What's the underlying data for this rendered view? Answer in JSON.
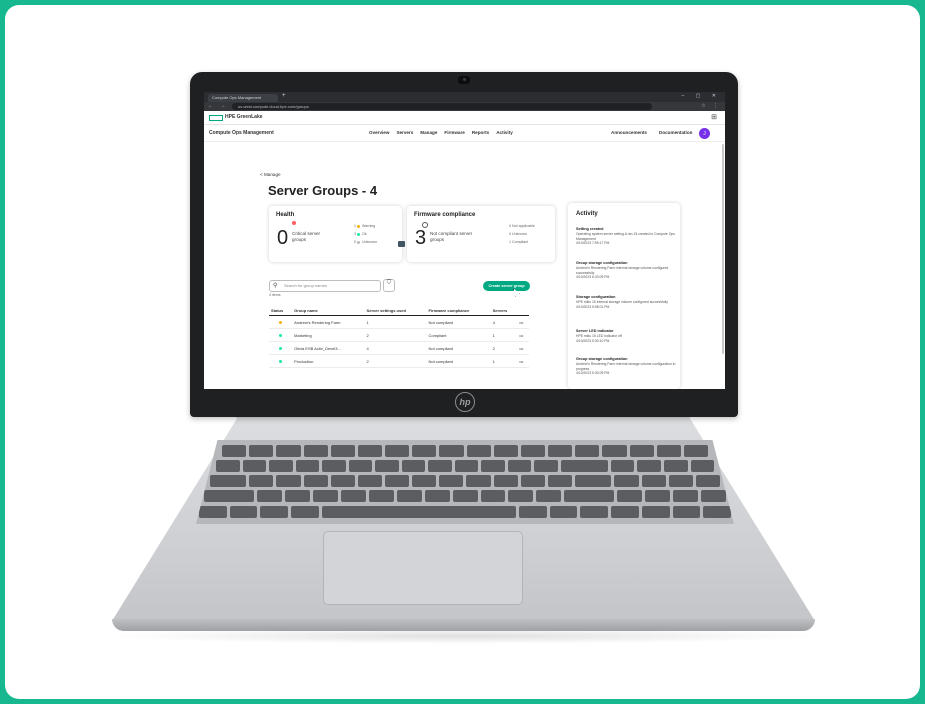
{
  "browser": {
    "tab_title": "Compute Ops Management",
    "tab_plus": "+",
    "window_controls": "– ▢ ✕",
    "nav_buttons": "← → ⟳",
    "url": "us-west.compute.cloud.hpe.com/groups",
    "toolbar_icons": "☆ ⋮"
  },
  "header": {
    "brand": "HPE GreenLake",
    "app_title": "Compute Ops Management",
    "nav": [
      "Overview",
      "Servers",
      "Manage",
      "Firmware",
      "Reports",
      "Activity"
    ],
    "right": [
      "Announcements",
      "Documentation"
    ],
    "avatar": "J"
  },
  "page": {
    "back_label": "< Manage",
    "title": "Server Groups - 4"
  },
  "health": {
    "heading": "Health",
    "count": "0",
    "label": "Critical server groups",
    "legend": [
      {
        "count": "1",
        "label": "Warning",
        "color": "#f4b400"
      },
      {
        "count": "3",
        "label": "Ok",
        "color": "#17eba0"
      },
      {
        "count": "0",
        "label": "Unknown",
        "color": "#bbbbbb"
      }
    ]
  },
  "firmware": {
    "heading": "Firmware compliance",
    "count": "3",
    "label": "Not compliant server groups",
    "legend": [
      {
        "count": "0",
        "label": "Not applicable"
      },
      {
        "count": "0",
        "label": "Unknown"
      },
      {
        "count": "1",
        "label": "Compliant"
      }
    ]
  },
  "toolbar": {
    "search_placeholder": "Search for group names",
    "items_count": "4 items",
    "create_label": "Create server group"
  },
  "table": {
    "headers": [
      "Status",
      "Group name",
      "Server settings used",
      "Firmware compliance",
      "Servers",
      ""
    ],
    "rows": [
      {
        "status_color": "#f4b400",
        "name": "Andrew's Rendering Farm",
        "settings": "1",
        "compliance": "Not compliant",
        "servers": "4",
        "actions": "•••"
      },
      {
        "status_color": "#17eba0",
        "name": "Marketing",
        "settings": "2",
        "compliance": "Compliant",
        "servers": "1",
        "actions": "•••"
      },
      {
        "status_color": "#17eba0",
        "name": "Olivia ESB Activ_Devel3...",
        "settings": "4",
        "compliance": "Not compliant",
        "servers": "2",
        "actions": "•••"
      },
      {
        "status_color": "#17eba0",
        "name": "Production",
        "settings": "2",
        "compliance": "Not compliant",
        "servers": "1",
        "actions": "•••"
      }
    ]
  },
  "activity": {
    "heading": "Activity",
    "items": [
      {
        "title": "Setting created",
        "desc": "Operating system server setting A ran 15 created in Compute Ops Management",
        "time": "4/10/2023 7:59:17 PM"
      },
      {
        "title": "Group storage configuration",
        "desc": "Andrew's Rendering Farm internal storage volume configured successfully",
        "time": "4/10/2023 6:33:09 PM"
      },
      {
        "title": "Storage configuration",
        "desc": "HPE mklu 15 internal storage volume configured successfully",
        "time": "4/10/2023 5:58:01 PM"
      },
      {
        "title": "Server LED indicator",
        "desc": "HPE mklu 15 LED indicator off",
        "time": "4/10/2023 5:30:10 PM"
      },
      {
        "title": "Group storage configuration",
        "desc": "Andrew's Rendering Farm internal storage volume configuration in progress",
        "time": "4/10/2023 5:30:09 PM"
      }
    ]
  },
  "device": {
    "brand_mark": "hp"
  }
}
